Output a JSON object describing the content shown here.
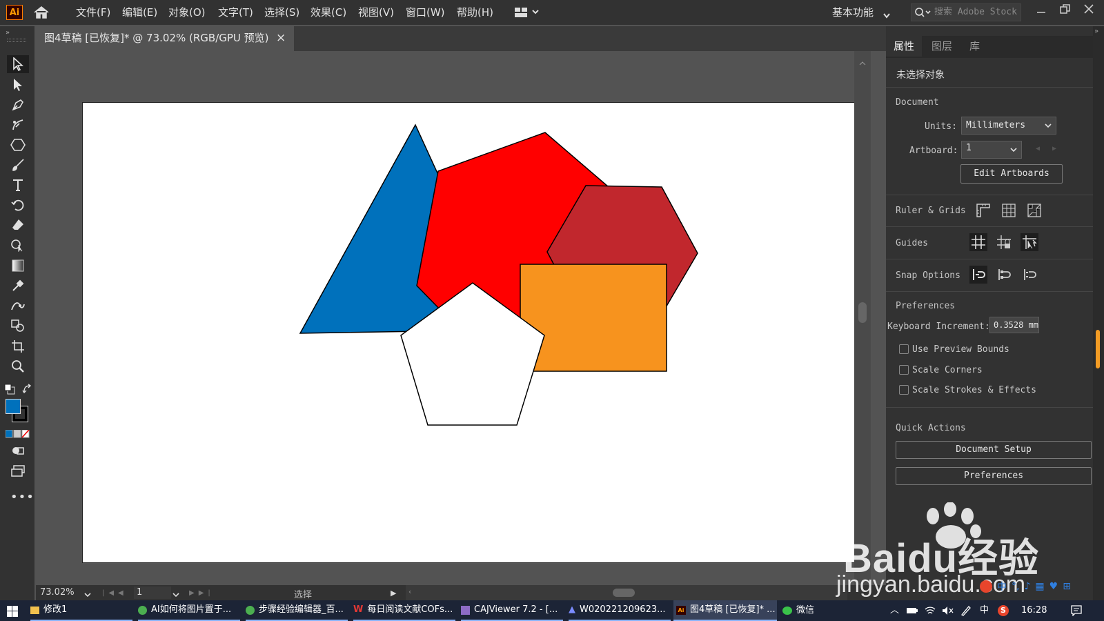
{
  "app": {
    "logo_text": "Ai",
    "menu": [
      "文件(F)",
      "编辑(E)",
      "对象(O)",
      "文字(T)",
      "选择(S)",
      "效果(C)",
      "视图(V)",
      "窗口(W)",
      "帮助(H)"
    ],
    "workspace": "基本功能",
    "search_placeholder": "搜索 Adobe Stock"
  },
  "document_tab": {
    "title": "图4草稿 [已恢复]* @ 73.02% (RGB/GPU 预览)",
    "close": "×"
  },
  "canvas": {
    "shapes": [
      {
        "name": "triangle",
        "fill": "#0071bc"
      },
      {
        "name": "red-hexagon",
        "fill": "#ff0000"
      },
      {
        "name": "dark-red-hexagon",
        "fill": "#c1272d"
      },
      {
        "name": "orange-rectangle",
        "fill": "#f7931e"
      },
      {
        "name": "white-pentagon",
        "fill": "#ffffff"
      }
    ]
  },
  "panel": {
    "tabs": [
      "属性",
      "图层",
      "库"
    ],
    "no_selection": "未选择对象",
    "document_heading": "Document",
    "units_label": "Units:",
    "units_value": "Millimeters",
    "artboard_label": "Artboard:",
    "artboard_value": "1",
    "edit_artboards": "Edit Artboards",
    "ruler_grids": "Ruler & Grids",
    "guides": "Guides",
    "snap_options": "Snap Options",
    "preferences_heading": "Preferences",
    "keyboard_increment_label": "Keyboard Increment:",
    "keyboard_increment_value": "0.3528 mm",
    "checkbox_preview_bounds": "Use Preview Bounds",
    "checkbox_scale_corners": "Scale Corners",
    "checkbox_scale_strokes": "Scale Strokes & Effects",
    "quick_actions": "Quick Actions",
    "document_setup": "Document Setup",
    "preferences_button": "Preferences"
  },
  "statusbar": {
    "zoom": "73.02%",
    "artboard_number": "1",
    "mode": "选择"
  },
  "taskbar": {
    "items": [
      "修改1",
      "AI如何将图片置于...",
      "步骤经验编辑器_百...",
      "每日阅读文献COFs...",
      "CAJViewer 7.2 - [...",
      "W020221209623...",
      "图4草稿 [已恢复]* ...",
      "微信"
    ],
    "ime": "中",
    "time": "16:28"
  },
  "watermark": {
    "brand": "Baidu经验",
    "url": "jingyan.baidu.com"
  },
  "colors": {
    "fill_swatch": "#0071bc",
    "stroke_swatch": "#000000",
    "accent": "#ff9a00"
  }
}
